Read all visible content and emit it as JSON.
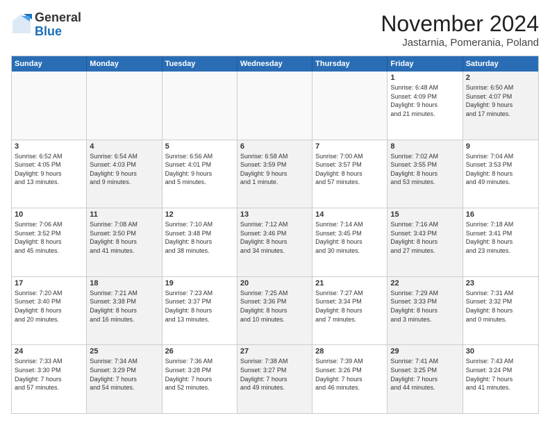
{
  "logo": {
    "general": "General",
    "blue": "Blue"
  },
  "header": {
    "month": "November 2024",
    "location": "Jastarnia, Pomerania, Poland"
  },
  "days_of_week": [
    "Sunday",
    "Monday",
    "Tuesday",
    "Wednesday",
    "Thursday",
    "Friday",
    "Saturday"
  ],
  "rows": [
    [
      {
        "day": "",
        "info": "",
        "empty": true
      },
      {
        "day": "",
        "info": "",
        "empty": true
      },
      {
        "day": "",
        "info": "",
        "empty": true
      },
      {
        "day": "",
        "info": "",
        "empty": true
      },
      {
        "day": "",
        "info": "",
        "empty": true
      },
      {
        "day": "1",
        "info": "Sunrise: 6:48 AM\nSunset: 4:09 PM\nDaylight: 9 hours\nand 21 minutes.",
        "empty": false
      },
      {
        "day": "2",
        "info": "Sunrise: 6:50 AM\nSunset: 4:07 PM\nDaylight: 9 hours\nand 17 minutes.",
        "empty": false,
        "shaded": true
      }
    ],
    [
      {
        "day": "3",
        "info": "Sunrise: 6:52 AM\nSunset: 4:05 PM\nDaylight: 9 hours\nand 13 minutes.",
        "empty": false
      },
      {
        "day": "4",
        "info": "Sunrise: 6:54 AM\nSunset: 4:03 PM\nDaylight: 9 hours\nand 9 minutes.",
        "empty": false,
        "shaded": true
      },
      {
        "day": "5",
        "info": "Sunrise: 6:56 AM\nSunset: 4:01 PM\nDaylight: 9 hours\nand 5 minutes.",
        "empty": false
      },
      {
        "day": "6",
        "info": "Sunrise: 6:58 AM\nSunset: 3:59 PM\nDaylight: 9 hours\nand 1 minute.",
        "empty": false,
        "shaded": true
      },
      {
        "day": "7",
        "info": "Sunrise: 7:00 AM\nSunset: 3:57 PM\nDaylight: 8 hours\nand 57 minutes.",
        "empty": false
      },
      {
        "day": "8",
        "info": "Sunrise: 7:02 AM\nSunset: 3:55 PM\nDaylight: 8 hours\nand 53 minutes.",
        "empty": false,
        "shaded": true
      },
      {
        "day": "9",
        "info": "Sunrise: 7:04 AM\nSunset: 3:53 PM\nDaylight: 8 hours\nand 49 minutes.",
        "empty": false
      }
    ],
    [
      {
        "day": "10",
        "info": "Sunrise: 7:06 AM\nSunset: 3:52 PM\nDaylight: 8 hours\nand 45 minutes.",
        "empty": false
      },
      {
        "day": "11",
        "info": "Sunrise: 7:08 AM\nSunset: 3:50 PM\nDaylight: 8 hours\nand 41 minutes.",
        "empty": false,
        "shaded": true
      },
      {
        "day": "12",
        "info": "Sunrise: 7:10 AM\nSunset: 3:48 PM\nDaylight: 8 hours\nand 38 minutes.",
        "empty": false
      },
      {
        "day": "13",
        "info": "Sunrise: 7:12 AM\nSunset: 3:46 PM\nDaylight: 8 hours\nand 34 minutes.",
        "empty": false,
        "shaded": true
      },
      {
        "day": "14",
        "info": "Sunrise: 7:14 AM\nSunset: 3:45 PM\nDaylight: 8 hours\nand 30 minutes.",
        "empty": false
      },
      {
        "day": "15",
        "info": "Sunrise: 7:16 AM\nSunset: 3:43 PM\nDaylight: 8 hours\nand 27 minutes.",
        "empty": false,
        "shaded": true
      },
      {
        "day": "16",
        "info": "Sunrise: 7:18 AM\nSunset: 3:41 PM\nDaylight: 8 hours\nand 23 minutes.",
        "empty": false
      }
    ],
    [
      {
        "day": "17",
        "info": "Sunrise: 7:20 AM\nSunset: 3:40 PM\nDaylight: 8 hours\nand 20 minutes.",
        "empty": false
      },
      {
        "day": "18",
        "info": "Sunrise: 7:21 AM\nSunset: 3:38 PM\nDaylight: 8 hours\nand 16 minutes.",
        "empty": false,
        "shaded": true
      },
      {
        "day": "19",
        "info": "Sunrise: 7:23 AM\nSunset: 3:37 PM\nDaylight: 8 hours\nand 13 minutes.",
        "empty": false
      },
      {
        "day": "20",
        "info": "Sunrise: 7:25 AM\nSunset: 3:36 PM\nDaylight: 8 hours\nand 10 minutes.",
        "empty": false,
        "shaded": true
      },
      {
        "day": "21",
        "info": "Sunrise: 7:27 AM\nSunset: 3:34 PM\nDaylight: 8 hours\nand 7 minutes.",
        "empty": false
      },
      {
        "day": "22",
        "info": "Sunrise: 7:29 AM\nSunset: 3:33 PM\nDaylight: 8 hours\nand 3 minutes.",
        "empty": false,
        "shaded": true
      },
      {
        "day": "23",
        "info": "Sunrise: 7:31 AM\nSunset: 3:32 PM\nDaylight: 8 hours\nand 0 minutes.",
        "empty": false
      }
    ],
    [
      {
        "day": "24",
        "info": "Sunrise: 7:33 AM\nSunset: 3:30 PM\nDaylight: 7 hours\nand 57 minutes.",
        "empty": false
      },
      {
        "day": "25",
        "info": "Sunrise: 7:34 AM\nSunset: 3:29 PM\nDaylight: 7 hours\nand 54 minutes.",
        "empty": false,
        "shaded": true
      },
      {
        "day": "26",
        "info": "Sunrise: 7:36 AM\nSunset: 3:28 PM\nDaylight: 7 hours\nand 52 minutes.",
        "empty": false
      },
      {
        "day": "27",
        "info": "Sunrise: 7:38 AM\nSunset: 3:27 PM\nDaylight: 7 hours\nand 49 minutes.",
        "empty": false,
        "shaded": true
      },
      {
        "day": "28",
        "info": "Sunrise: 7:39 AM\nSunset: 3:26 PM\nDaylight: 7 hours\nand 46 minutes.",
        "empty": false
      },
      {
        "day": "29",
        "info": "Sunrise: 7:41 AM\nSunset: 3:25 PM\nDaylight: 7 hours\nand 44 minutes.",
        "empty": false,
        "shaded": true
      },
      {
        "day": "30",
        "info": "Sunrise: 7:43 AM\nSunset: 3:24 PM\nDaylight: 7 hours\nand 41 minutes.",
        "empty": false
      }
    ]
  ]
}
